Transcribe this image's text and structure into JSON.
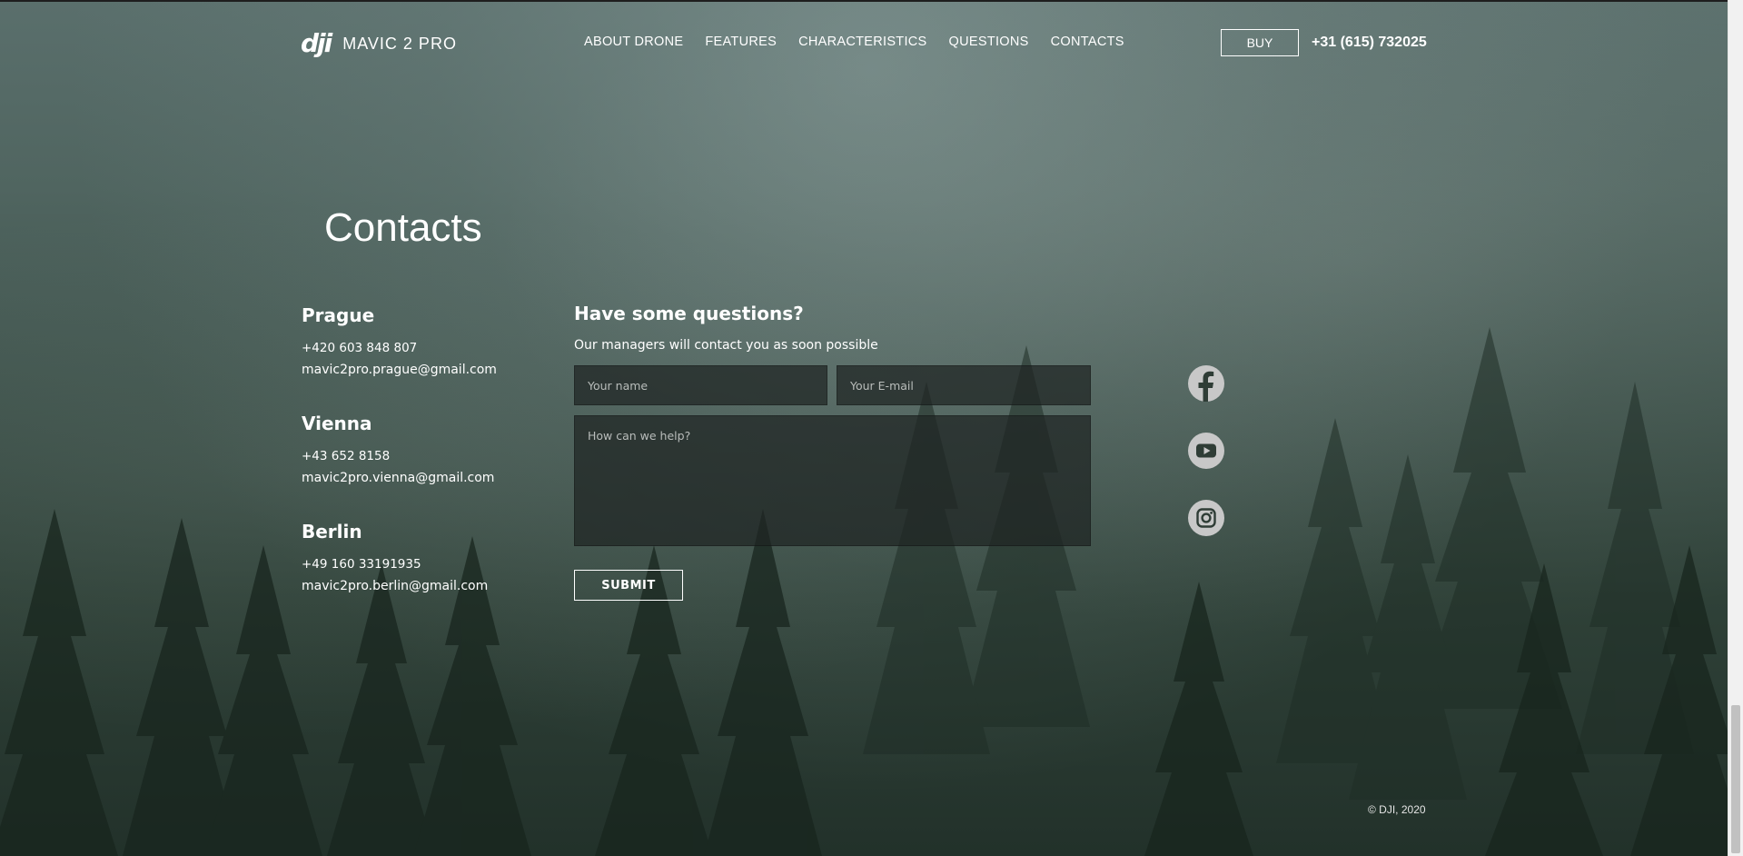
{
  "header": {
    "logo_mark": "dji",
    "logo_text": "MAVIC 2 PRO",
    "nav": [
      "ABOUT DRONE",
      "FEATURES",
      "CHARACTERISTICS",
      "QUESTIONS",
      "CONTACTS"
    ],
    "buy_label": "BUY",
    "phone": "+31 (615) 732025"
  },
  "page": {
    "title": "Contacts"
  },
  "offices": [
    {
      "city": "Prague",
      "phone": "+420 603 848 807",
      "email": "mavic2pro.prague@gmail.com"
    },
    {
      "city": "Vienna",
      "phone": "+43 652 8158",
      "email": "mavic2pro.vienna@gmail.com"
    },
    {
      "city": "Berlin",
      "phone": "+49 160 33191935",
      "email": "mavic2pro.berlin@gmail.com"
    }
  ],
  "form": {
    "title": "Have some questions?",
    "subtitle": "Our managers will contact you as soon possible",
    "name_placeholder": "Your name",
    "email_placeholder": "Your E-mail",
    "message_placeholder": "How can we help?",
    "submit_label": "SUBMIT"
  },
  "social": {
    "icons": [
      "facebook-icon",
      "youtube-icon",
      "instagram-icon"
    ],
    "icon_color": "#c8c8c8"
  },
  "footer": {
    "copyright": "© DJI, 2020"
  },
  "colors": {
    "background_top": "#5a6f6c",
    "background_bottom": "#22312a",
    "text": "#ffffff"
  }
}
